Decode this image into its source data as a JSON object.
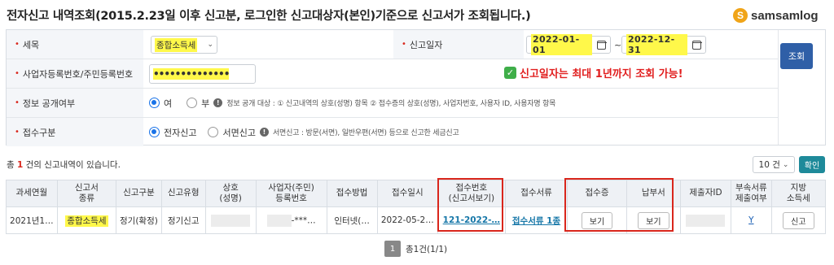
{
  "header": {
    "title": "전자신고 내역조회(2015.2.23일 이후 신고분, 로그인한  신고대상자(본인)기준으로  신고서가 조회됩니다.)",
    "brand": "samsamlog",
    "brand_mark": "S"
  },
  "form": {
    "tax_label": "세목",
    "tax_value": "종합소득세",
    "period_label": "신고일자",
    "date_from": "2022-01-01",
    "date_to": "2022-12-31",
    "date_sep": "~",
    "regno_label": "사업자등록번호/주민등록번호",
    "regno_value": "••••••••••••••",
    "notice": "신고일자는 최대 1년까지 조회 가능!",
    "disclose_label": "정보 공개여부",
    "disclose_yes": "여",
    "disclose_no": "부",
    "disclose_info": "정보 공개 대상 : ① 신고내역의 상호(성명) 항목 ② 접수증의 상호(성명), 사업자번호, 사용자 ID, 사용자명 항목",
    "receipt_label": "접수구분",
    "receipt_electronic": "전자신고",
    "receipt_paper": "서면신고",
    "receipt_info": "서면신고 : 방문(서면), 일반우편(서면) 등으로 신고한 세금신고",
    "search_button": "조회"
  },
  "results": {
    "count_prefix": "총 ",
    "count": "1",
    "count_suffix": " 건의 신고내역이 있습니다.",
    "page_size": "10 건",
    "confirm_button": "확인"
  },
  "table": {
    "headers": [
      "과세연월",
      "신고서\n종류",
      "신고구분",
      "신고유형",
      "상호\n(성명)",
      "사업자(주민)\n등록번호",
      "접수방법",
      "접수일시",
      "접수번호\n(신고서보기)",
      "접수서류",
      "접수증",
      "납부서",
      "제출자ID",
      "부속서류\n제출여부",
      "지방\n소득세"
    ],
    "row": {
      "period": "2021년1…",
      "form_type": "종합소득세",
      "report_kind": "정기(확정)",
      "report_type": "정기신고",
      "masked_no": "-***…",
      "method": "인터넷(…",
      "datetime": "2022-05-2…",
      "receipt_no": "121-2022-…",
      "docs_link": "접수서류 1종",
      "view1": "보기",
      "view2": "보기",
      "attached": "Y",
      "local_tax_button": "신고"
    }
  },
  "pager": {
    "current": "1",
    "summary": "총1건(1/1)"
  }
}
